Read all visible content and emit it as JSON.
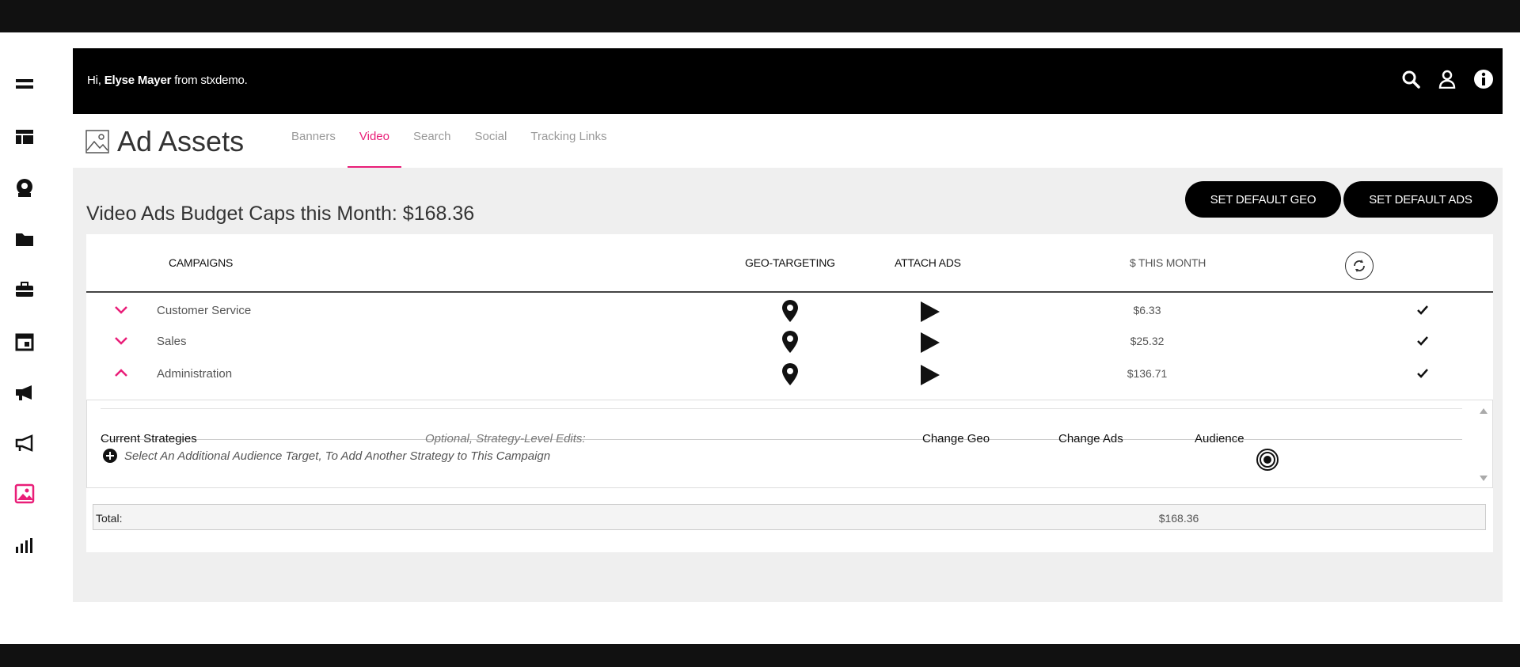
{
  "header": {
    "greeting_prefix": "Hi,",
    "user_name": "Elyse Mayer",
    "greeting_suffix": "from stxdemo."
  },
  "nav": {
    "items": [
      "menu-icon",
      "dashboard-icon",
      "user-icon",
      "folder-icon",
      "briefcase-icon",
      "calendar-icon",
      "megaphone-icon",
      "announce-icon",
      "image-icon",
      "chart-icon"
    ],
    "active_item": "image-icon",
    "accent_color": "#e91e78"
  },
  "page": {
    "title": "Ad Assets",
    "tabs": [
      {
        "label": "Banners",
        "active": false
      },
      {
        "label": "Video",
        "active": true
      },
      {
        "label": "Search",
        "active": false
      },
      {
        "label": "Social",
        "active": false
      },
      {
        "label": "Tracking Links",
        "active": false
      }
    ]
  },
  "budget": {
    "title": "Video Ads Budget Caps this Month: $168.36",
    "set_default_geo": "SET DEFAULT GEO",
    "set_default_ads": "SET DEFAULT ADS"
  },
  "table": {
    "headers": {
      "campaigns": "CAMPAIGNS",
      "geo": "GEO-TARGETING",
      "attach": "ATTACH ADS",
      "month": "$ THIS MONTH"
    },
    "rows": [
      {
        "name": "Customer Service",
        "amount": "$6.33",
        "expanded": false
      },
      {
        "name": "Sales",
        "amount": "$25.32",
        "expanded": false
      },
      {
        "name": "Administration",
        "amount": "$136.71",
        "expanded": true
      }
    ]
  },
  "strategies": {
    "current": "Current Strategies",
    "optional": "Optional, Strategy-Level Edits:",
    "change_geo": "Change Geo",
    "change_ads": "Change Ads",
    "audience": "Audience",
    "add_text": "Select An Additional Audience Target, To Add Another Strategy to This Campaign"
  },
  "total": {
    "label": "Total:",
    "value": "$168.36"
  }
}
